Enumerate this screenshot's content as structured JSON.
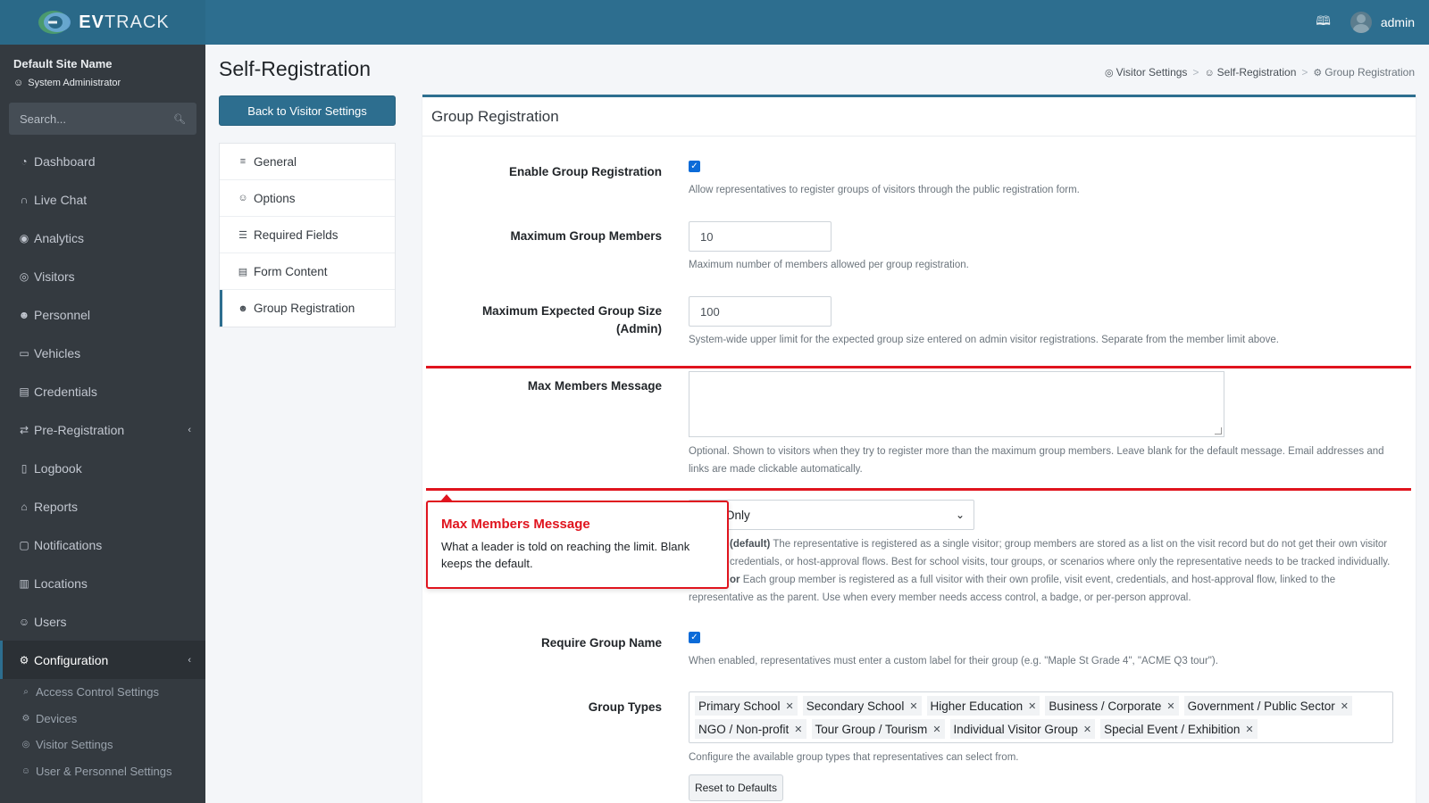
{
  "brand": {
    "name_bold": "EV",
    "name_rest": "TRACK"
  },
  "topbar": {
    "user_name": "admin"
  },
  "sidebar": {
    "site_name": "Default Site Name",
    "site_role": "System Administrator",
    "search_placeholder": "Search...",
    "items": [
      {
        "label": "Dashboard",
        "icon": "gauge-icon"
      },
      {
        "label": "Live Chat",
        "icon": "headset-icon"
      },
      {
        "label": "Analytics",
        "icon": "target-icon"
      },
      {
        "label": "Visitors",
        "icon": "eye-icon"
      },
      {
        "label": "Personnel",
        "icon": "user-tie-icon"
      },
      {
        "label": "Vehicles",
        "icon": "car-icon"
      },
      {
        "label": "Credentials",
        "icon": "id-card-icon"
      },
      {
        "label": "Pre-Registration",
        "icon": "arrows-icon"
      },
      {
        "label": "Logbook",
        "icon": "book-icon"
      },
      {
        "label": "Reports",
        "icon": "chart-icon"
      },
      {
        "label": "Notifications",
        "icon": "bell-icon"
      },
      {
        "label": "Locations",
        "icon": "building-icon"
      },
      {
        "label": "Users",
        "icon": "users-icon"
      },
      {
        "label": "Configuration",
        "icon": "gear-icon"
      }
    ],
    "sub_items": [
      {
        "label": "Access Control Settings",
        "icon": "key-icon"
      },
      {
        "label": "Devices",
        "icon": "gear-icon"
      },
      {
        "label": "Visitor Settings",
        "icon": "eye-icon"
      },
      {
        "label": "User & Personnel Settings",
        "icon": "user-gear-icon"
      }
    ]
  },
  "page": {
    "title": "Self-Registration",
    "back_button": "Back to Visitor Settings",
    "breadcrumb": [
      "Visitor Settings",
      "Self-Registration",
      "Group Registration"
    ]
  },
  "subnav": {
    "items": [
      {
        "label": "General",
        "icon": "sliders-icon"
      },
      {
        "label": "Options",
        "icon": "user-gear-icon"
      },
      {
        "label": "Required Fields",
        "icon": "list-check-icon"
      },
      {
        "label": "Form Content",
        "icon": "file-icon"
      },
      {
        "label": "Group Registration",
        "icon": "users-icon"
      }
    ]
  },
  "card": {
    "title": "Group Registration",
    "enable_group": {
      "label": "Enable Group Registration",
      "checked": true,
      "help": "Allow representatives to register groups of visitors through the public registration form."
    },
    "max_members": {
      "label": "Maximum Group Members",
      "value": "10",
      "help": "Maximum number of members allowed per group registration."
    },
    "max_expected": {
      "label_line1": "Maximum Expected Group Size",
      "label_line2": "(Admin)",
      "value": "100",
      "help": "System-wide upper limit for the expected group size entered on admin visitor registrations. Separate from the member limit above."
    },
    "max_message": {
      "label": "Max Members Message",
      "value": "",
      "help_line1": "Optional. Shown to visitors when they try to register more than the maximum group members. Leave blank for the default message. Email addresses and",
      "help_line2": "links are made clickable automatically."
    },
    "mode": {
      "selected": "Only",
      "help1_bold": "(default)",
      "help1_rest": " The representative is registered as a single visitor; group members are stored as a list on the visit record but do not get their own visitor",
      "help2": "credentials, or host-approval flows. Best for school visits, tour groups, or scenarios where only the representative needs to be tracked individually.",
      "help3_bold": "or",
      "help3_rest": " Each group member is registered as a full visitor with their own profile, visit event, credentials, and host-approval flow, linked to the",
      "help4": "representative as the parent. Use when every member needs access control, a badge, or per-person approval."
    },
    "require_name": {
      "label": "Require Group Name",
      "checked": true,
      "help": "When enabled, representatives must enter a custom label for their group (e.g. \"Maple St Grade 4\", \"ACME Q3 tour\")."
    },
    "group_types": {
      "label": "Group Types",
      "tags": [
        "Primary School",
        "Secondary School",
        "Higher Education",
        "Business / Corporate",
        "Government / Public Sector",
        "NGO / Non-profit",
        "Tour Group / Tourism",
        "Individual Visitor Group",
        "Special Event / Exhibition"
      ],
      "help": "Configure the available group types that representatives can select from.",
      "reset_button": "Reset to Defaults"
    }
  },
  "callout": {
    "title": "Max Members Message",
    "body": "What a leader is told on reaching the limit. Blank keeps the default."
  },
  "colors": {
    "accent": "#2d6e8f",
    "sidebar": "#343a40",
    "highlight": "#e0141e"
  }
}
